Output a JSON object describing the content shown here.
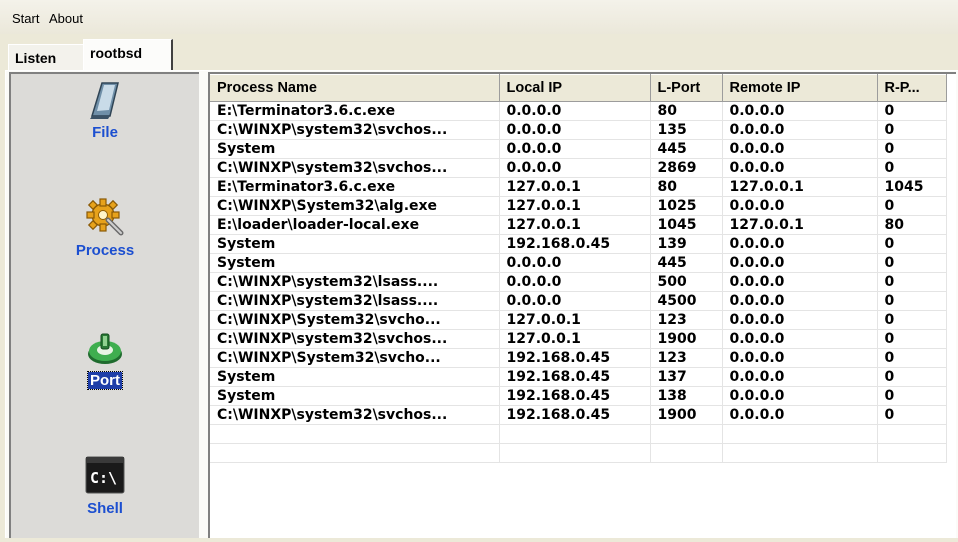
{
  "menu": {
    "items": [
      "Start",
      "About"
    ]
  },
  "tabs": [
    {
      "label": "Listen"
    },
    {
      "label": "rootbsd",
      "selected": true
    }
  ],
  "nav": {
    "items": [
      {
        "label": "File",
        "icon": "file-icon"
      },
      {
        "label": "Process",
        "icon": "gear-process-icon"
      },
      {
        "label": "Port",
        "icon": "port-icon",
        "selected": true
      },
      {
        "label": "Shell",
        "icon": "shell-icon"
      }
    ]
  },
  "table": {
    "columns": [
      "Process Name",
      "Local IP",
      "L-Port",
      "Remote IP",
      "R-P..."
    ],
    "rows": [
      [
        "E:\\Terminator3.6.c.exe",
        "0.0.0.0",
        "80",
        "0.0.0.0",
        "0"
      ],
      [
        "C:\\WINXP\\system32\\svchos...",
        "0.0.0.0",
        "135",
        "0.0.0.0",
        "0"
      ],
      [
        "System",
        "0.0.0.0",
        "445",
        "0.0.0.0",
        "0"
      ],
      [
        "C:\\WINXP\\system32\\svchos...",
        "0.0.0.0",
        "2869",
        "0.0.0.0",
        "0"
      ],
      [
        "E:\\Terminator3.6.c.exe",
        "127.0.0.1",
        "80",
        "127.0.0.1",
        "1045"
      ],
      [
        "C:\\WINXP\\System32\\alg.exe",
        "127.0.0.1",
        "1025",
        "0.0.0.0",
        "0"
      ],
      [
        "E:\\loader\\loader-local.exe",
        "127.0.0.1",
        "1045",
        "127.0.0.1",
        "80"
      ],
      [
        "System",
        "192.168.0.45",
        "139",
        "0.0.0.0",
        "0"
      ],
      [
        "System",
        "0.0.0.0",
        "445",
        "0.0.0.0",
        "0"
      ],
      [
        "C:\\WINXP\\system32\\lsass....",
        "0.0.0.0",
        "500",
        "0.0.0.0",
        "0"
      ],
      [
        "C:\\WINXP\\system32\\lsass....",
        "0.0.0.0",
        "4500",
        "0.0.0.0",
        "0"
      ],
      [
        "C:\\WINXP\\System32\\svcho...",
        "127.0.0.1",
        "123",
        "0.0.0.0",
        "0"
      ],
      [
        "C:\\WINXP\\system32\\svchos...",
        "127.0.0.1",
        "1900",
        "0.0.0.0",
        "0"
      ],
      [
        "C:\\WINXP\\System32\\svcho...",
        "192.168.0.45",
        "123",
        "0.0.0.0",
        "0"
      ],
      [
        "System",
        "192.168.0.45",
        "137",
        "0.0.0.0",
        "0"
      ],
      [
        "System",
        "192.168.0.45",
        "138",
        "0.0.0.0",
        "0"
      ],
      [
        "C:\\WINXP\\system32\\svchos...",
        "192.168.0.45",
        "1900",
        "0.0.0.0",
        "0"
      ],
      [
        "",
        "",
        "",
        "",
        ""
      ],
      [
        "",
        "",
        "",
        "",
        ""
      ]
    ]
  },
  "colors": {
    "nav_label": "#1c4fd0",
    "selected_bg": "#1e3ea8",
    "window_bg": "#ece9d8"
  }
}
